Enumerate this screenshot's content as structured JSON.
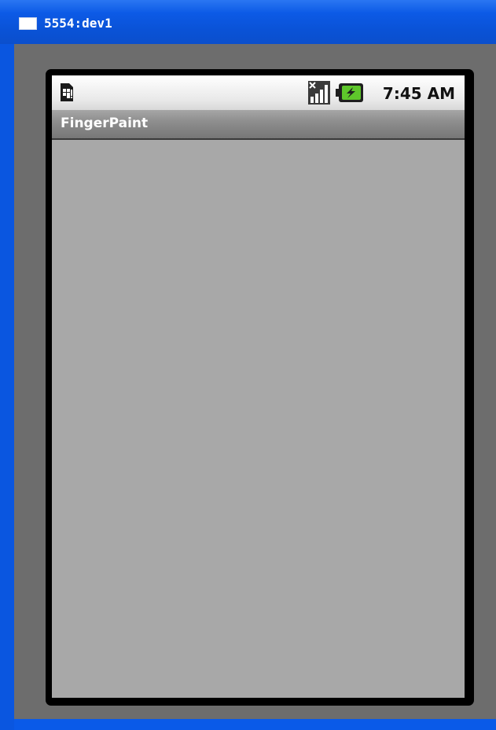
{
  "window": {
    "title": "5554:dev1"
  },
  "status_bar": {
    "time": "7:45 AM",
    "icons": [
      "sim-card-icon",
      "signal-no-service-icon",
      "battery-charging-icon"
    ]
  },
  "app": {
    "title": "FingerPaint"
  },
  "colors": {
    "titlebar": "#0c5ae6",
    "emulator_bg": "#6d6d6d",
    "canvas": "#a8a8a8",
    "battery_green": "#5ec62b"
  }
}
